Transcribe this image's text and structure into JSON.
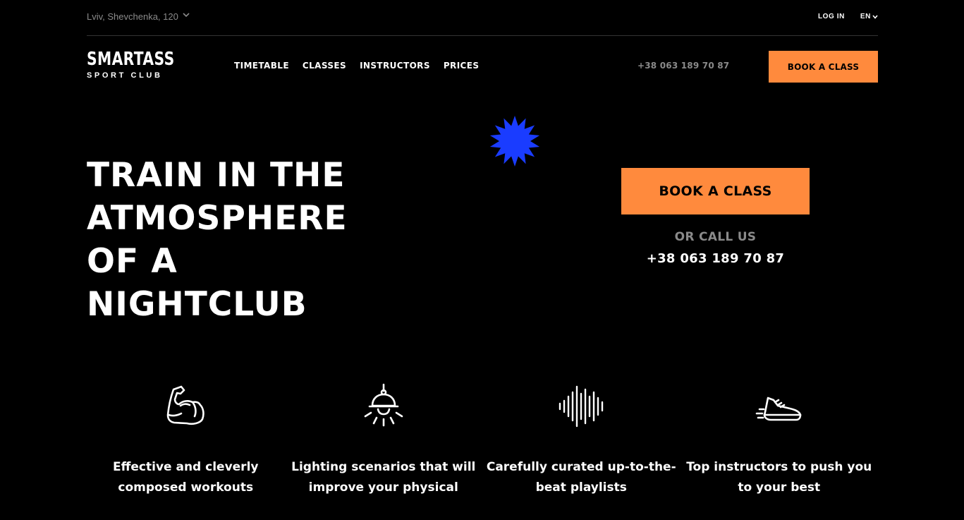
{
  "topbar": {
    "location": "Lviv, Shevchenka, 120",
    "login": "LOG IN",
    "language": "EN"
  },
  "brand": {
    "name": "SMARTASS",
    "tagline": "SPORT CLUB"
  },
  "nav": {
    "items": [
      {
        "label": "TIMETABLE"
      },
      {
        "label": "CLASSES"
      },
      {
        "label": "INSTRUCTORS"
      },
      {
        "label": "PRICES"
      }
    ]
  },
  "header": {
    "phone": "+38 063 189 70 87",
    "book_label": "BOOK A CLASS"
  },
  "hero": {
    "headline": [
      "TRAIN IN THE",
      "ATMOSPHERE",
      "OF A",
      "NIGHTCLUB"
    ],
    "book_label": "BOOK A CLASS",
    "or_call": "OR CALL US",
    "phone": "+38 063 189 70 87"
  },
  "features": [
    {
      "icon": "muscle-arm-icon",
      "text": "Effective and cleverly composed workouts"
    },
    {
      "icon": "ceiling-lamp-icon",
      "text": "Lighting scenarios that will improve your physical"
    },
    {
      "icon": "sound-wave-icon",
      "text": "Carefully curated up-to-the-beat playlists"
    },
    {
      "icon": "running-shoe-icon",
      "text": "Top instructors to push you to your best"
    }
  ],
  "colors": {
    "accent": "#ff8a3d",
    "star": "#1a3cff",
    "background": "#000000",
    "muted": "#8a8a8a"
  }
}
